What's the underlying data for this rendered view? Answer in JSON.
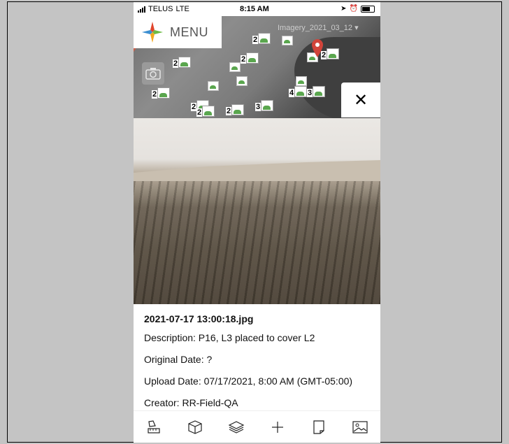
{
  "status_bar": {
    "carrier": "TELUS",
    "network": "LTE",
    "time": "8:15 AM"
  },
  "map": {
    "menu_label": "MENU",
    "imagery_layer": "Imagery_2021_03_12",
    "cluster_counts": [
      "2",
      "2",
      "2",
      "2",
      "2",
      "4",
      "3",
      "2",
      "2",
      "2",
      "3"
    ]
  },
  "photo_details": {
    "filename": "2021-07-17 13:00:18.jpg",
    "description": "Description: P16, L3 placed to cover L2",
    "original_date": "Original Date: ?",
    "upload_date": "Upload Date: 07/17/2021, 8:00 AM (GMT-05:00)",
    "creator": "Creator: RR-Field-QA"
  },
  "toolbar": {
    "items": [
      "measure-icon",
      "cube-icon",
      "layers-icon",
      "crosshair-icon",
      "note-icon",
      "image-icon"
    ]
  },
  "colors": {
    "accent_red": "#c95e4a",
    "marker_green": "#5aa64e"
  }
}
